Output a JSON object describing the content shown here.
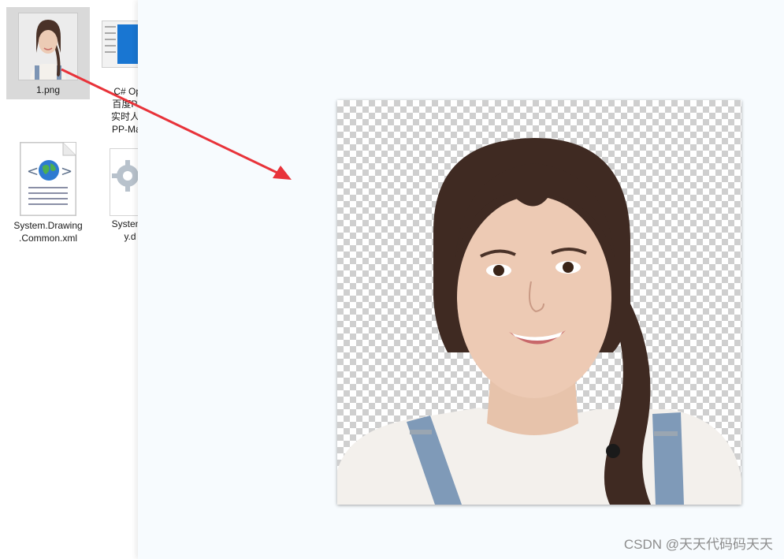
{
  "files": [
    {
      "label": "1.png",
      "icon": "photo-thumbnail-icon",
      "selected": true
    },
    {
      "label": "C# Ope\n百度Pad\n实时人像\nPP-Matti",
      "icon": "app-window-icon"
    },
    {
      "label": "System.Drawing\n.Common.xml",
      "icon": "xml-document-icon"
    },
    {
      "label": "System.I\ny.d",
      "icon": "gear-settings-icon"
    }
  ],
  "viewer": {
    "image_description_icon": "portrait-cutout-transparent-background"
  },
  "watermark": "CSDN @天天代码码天天",
  "colors": {
    "arrow": "#e8333a",
    "viewer_bg": "#f7fbfe",
    "selection": "#d9d9d9"
  }
}
